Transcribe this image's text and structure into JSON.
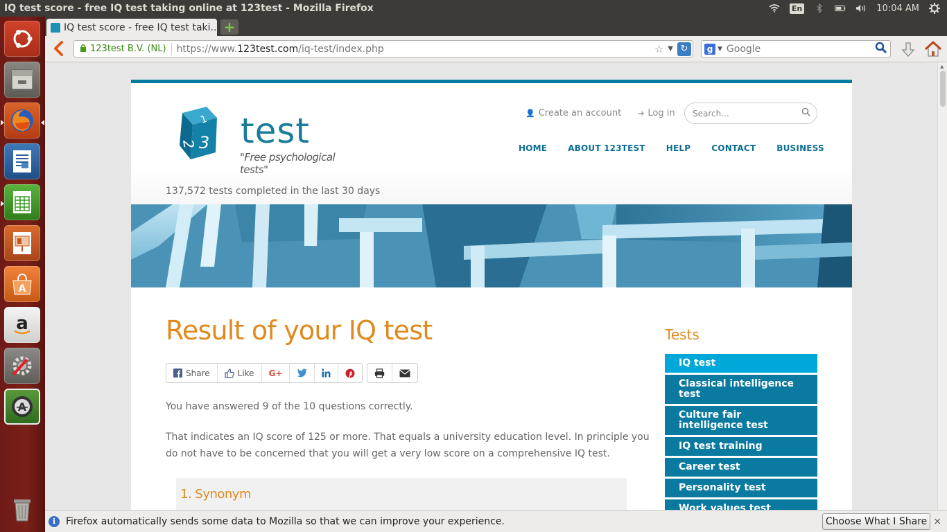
{
  "window": {
    "title": "IQ test score - free IQ test taking online at 123test - Mozilla Firefox"
  },
  "tray": {
    "lang": "En",
    "clock": "10:04 AM"
  },
  "browser": {
    "tab_title": "IQ test score - free IQ test taki...",
    "tab_close": "×",
    "new_tab": "+",
    "identity": "123test B.V. (NL)",
    "url_prefix": "https://www.",
    "url_host": "123test.com",
    "url_path": "/iq-test/index.php",
    "search_engine": "Google"
  },
  "site": {
    "logo_word": "test",
    "logo_slogan": "\"Free psychological tests\"",
    "create_account": "Create an account",
    "login": "Log in",
    "search_placeholder": "Search...",
    "nav": [
      "HOME",
      "ABOUT 123TEST",
      "HELP",
      "CONTACT",
      "BUSINESS"
    ],
    "counter": "137,572 tests completed in the last 30 days",
    "heading": "Result of your IQ test",
    "share": {
      "share": "Share",
      "like": "Like",
      "gplus": "G+"
    },
    "p1": "You have answered 9 of the 10 questions correctly.",
    "p2": "That indicates an IQ score of 125 or more. That equals a university education level. In principle you do not have to be concerned that you will get a very low score on a comprehensive IQ test.",
    "question_title": "1. Synonym",
    "sidebar_title": "Tests",
    "tests": [
      "IQ test",
      "Classical intelligence test",
      "Culture fair intelligence test",
      "IQ test training",
      "Career test",
      "Personality test",
      "Work values test"
    ]
  },
  "notification": {
    "text": "Firefox automatically sends some data to Mozilla so that we can improve your experience.",
    "button": "Choose What I Share",
    "close": "×"
  },
  "colors": {
    "accent": "#0a7aa0",
    "active": "#00a8d9",
    "heading": "#e08a1e",
    "launcher": "#7a2018"
  }
}
